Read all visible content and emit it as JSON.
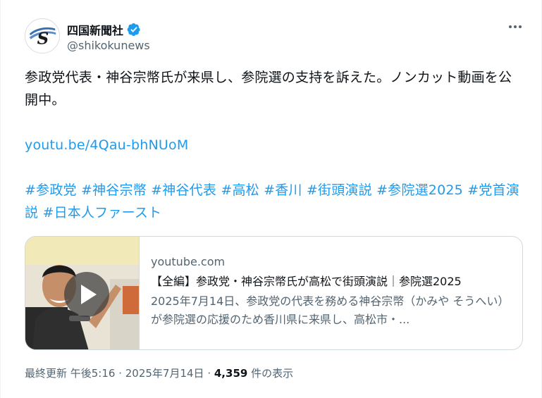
{
  "account": {
    "display_name": "四国新聞社",
    "handle": "@shikokunews",
    "avatar_letter": "S",
    "verified_color": "#1d9bf0"
  },
  "tweet": {
    "text_line1": "参政党代表・神谷宗幣氏が来県し、参院選の支持を訴えた。ノンカット動画を公開中。",
    "link": "youtu.be/4Qau-bhNUoM",
    "hashtags": [
      "#参政党",
      "#神谷宗幣",
      "#神谷代表",
      "#高松",
      "#香川",
      "#街頭演説",
      "#参院選2025",
      "#党首演説",
      "#日本人ファースト"
    ]
  },
  "card": {
    "domain": "youtube.com",
    "title": "【全編】参政党・神谷宗幣氏が高松で街頭演説｜参院選2025",
    "description": "2025年7月14日、参政党の代表を務める神谷宗幣（かみや そうへい）が参院選の応援のため香川県に来県し、高松市・..."
  },
  "meta": {
    "prefix": "最終更新 午後5:16 · 2025年7月14日 · ",
    "views": "4,359",
    "views_suffix": " 件の表示"
  },
  "colors": {
    "link": "#1d9bf0",
    "text": "#0f1419",
    "secondary": "#536471",
    "border": "#cfd9de"
  },
  "icons": {
    "more": "more-horizontal-icon",
    "verified": "verified-badge-icon",
    "play": "play-icon"
  }
}
